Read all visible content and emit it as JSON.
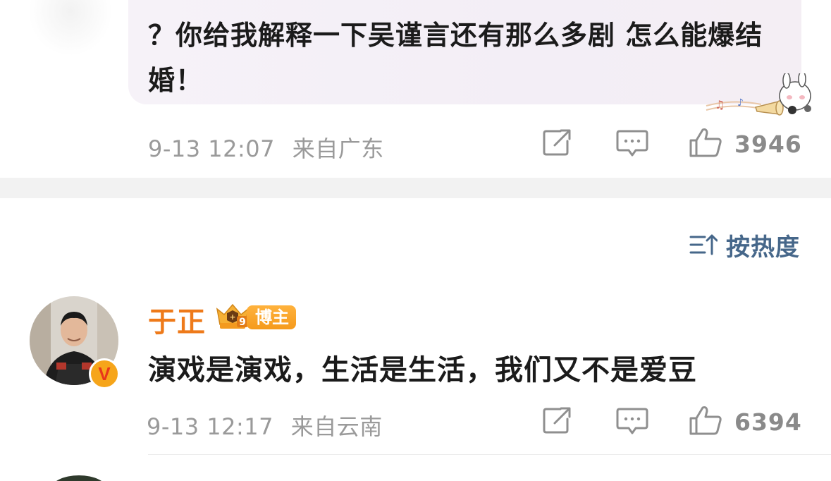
{
  "quoted_post": {
    "text": "？你给我解释一下吴谨言还有那么多剧 怎么能爆结婚！",
    "timestamp": "9-13 12:07",
    "location": "来自广东",
    "like_count": "3946"
  },
  "sort": {
    "label": "按热度",
    "icon": "sort-icon"
  },
  "comment": {
    "username": "于正",
    "level_badge": "9",
    "role_tag": "博主",
    "verified_badge": "V",
    "text": "演戏是演戏，生活是生活，我们又不是爱豆",
    "timestamp": "9-13 12:17",
    "location": "来自云南",
    "like_count": "6394"
  },
  "colors": {
    "username": "#ee7a1a",
    "sort_text": "#46678a",
    "meta_text": "#9a9a9a",
    "role_tag": "#f59a1c",
    "verified": "#f6a51a"
  },
  "icons": [
    "share-icon",
    "comment-icon",
    "like-icon",
    "sort-icon",
    "level-badge-icon",
    "verified-badge-icon"
  ]
}
